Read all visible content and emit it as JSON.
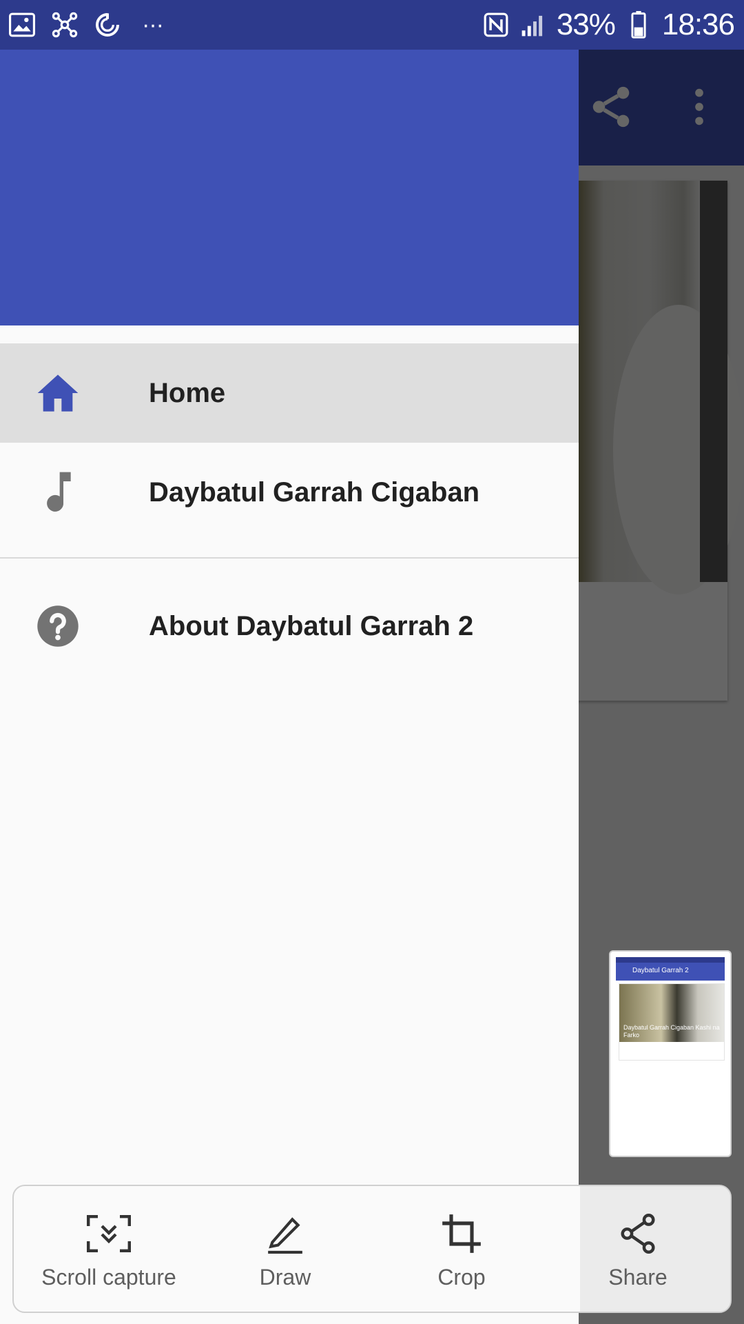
{
  "status_bar": {
    "battery_percent": "33%",
    "time": "18:36",
    "overflow_label": "···"
  },
  "drawer": {
    "items": [
      {
        "label": "Home",
        "icon": "home-icon",
        "active": true
      },
      {
        "label": "Daybatul Garrah Cigaban",
        "icon": "music-note-icon",
        "active": false
      },
      {
        "label": "About Daybatul Garrah 2",
        "icon": "help-icon",
        "active": false
      }
    ]
  },
  "thumbnail": {
    "title": "Daybatul Garrah 2",
    "card_caption": "Daybatul Garrah Cigaban Kashi na Farko"
  },
  "capture_toolbar": {
    "scroll_capture": "Scroll capture",
    "draw": "Draw",
    "crop": "Crop",
    "share": "Share"
  },
  "colors": {
    "primary": "#3f51b5",
    "status_bar": "#2d3a8c",
    "drawer_bg": "#fafafa",
    "active_item_bg": "#dedede"
  }
}
